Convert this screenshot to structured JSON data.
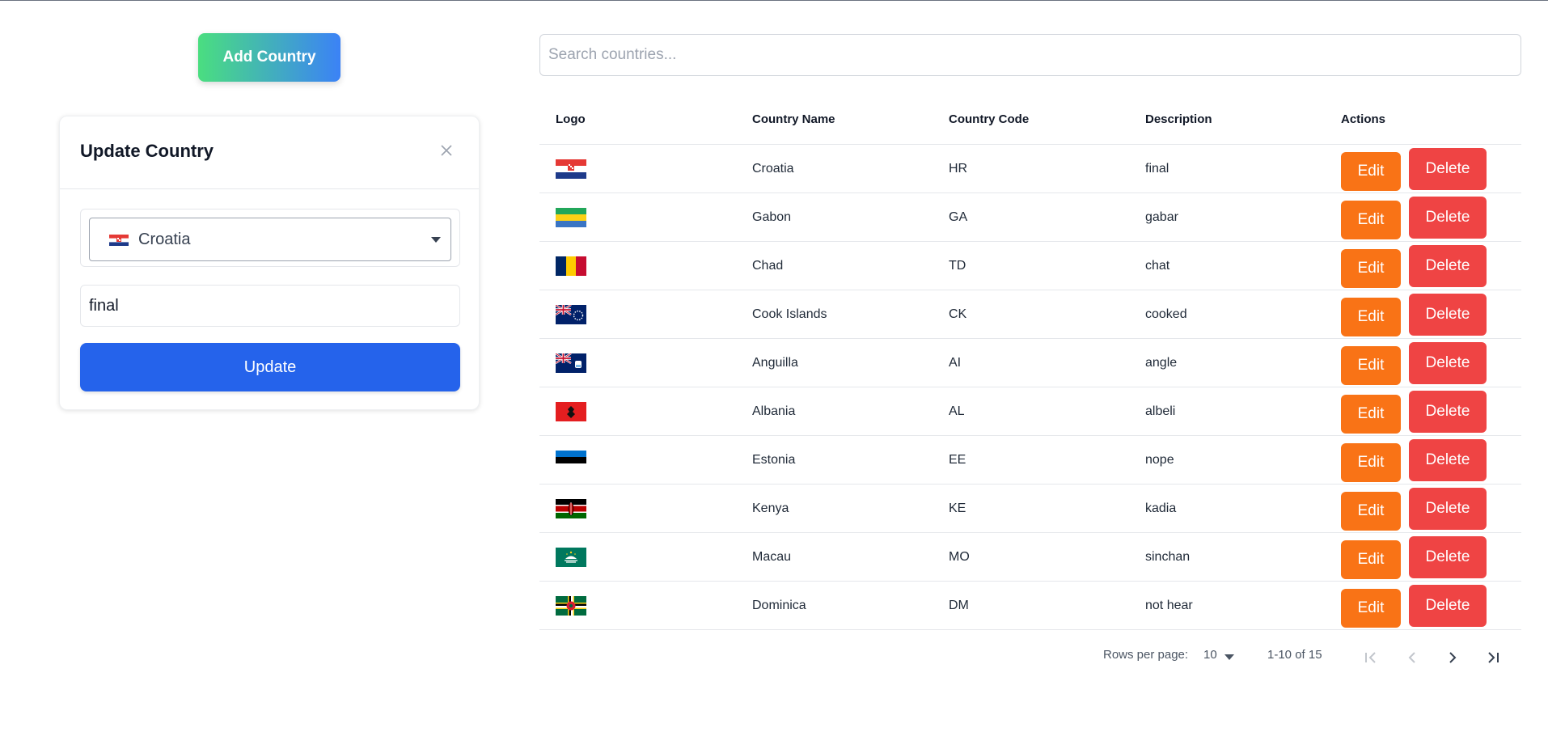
{
  "toolbar": {
    "add_label": "Add Country"
  },
  "modal": {
    "title": "Update Country",
    "selected_country": "Croatia",
    "selected_flag": "HR",
    "description_value": "final",
    "update_label": "Update"
  },
  "search": {
    "placeholder": "Search countries...",
    "value": ""
  },
  "table": {
    "columns": [
      "Logo",
      "Country Name",
      "Country Code",
      "Description",
      "Actions"
    ],
    "edit_label": "Edit",
    "delete_label": "Delete",
    "rows": [
      {
        "name": "Croatia",
        "code": "HR",
        "description": "final"
      },
      {
        "name": "Gabon",
        "code": "GA",
        "description": "gabar"
      },
      {
        "name": "Chad",
        "code": "TD",
        "description": "chat"
      },
      {
        "name": "Cook Islands",
        "code": "CK",
        "description": "cooked"
      },
      {
        "name": "Anguilla",
        "code": "AI",
        "description": "angle"
      },
      {
        "name": "Albania",
        "code": "AL",
        "description": "albeli"
      },
      {
        "name": "Estonia",
        "code": "EE",
        "description": "nope"
      },
      {
        "name": "Kenya",
        "code": "KE",
        "description": "kadia"
      },
      {
        "name": "Macau",
        "code": "MO",
        "description": "sinchan"
      },
      {
        "name": "Dominica",
        "code": "DM",
        "description": "not hear"
      }
    ]
  },
  "pagination": {
    "rows_per_page_label": "Rows per page:",
    "rows_per_page": "10",
    "range": "1-10 of 15"
  },
  "colors": {
    "primary": "#2563eb",
    "edit": "#f97316",
    "delete": "#ef4444",
    "gradient_start": "#4ade80",
    "gradient_end": "#3b82f6"
  }
}
